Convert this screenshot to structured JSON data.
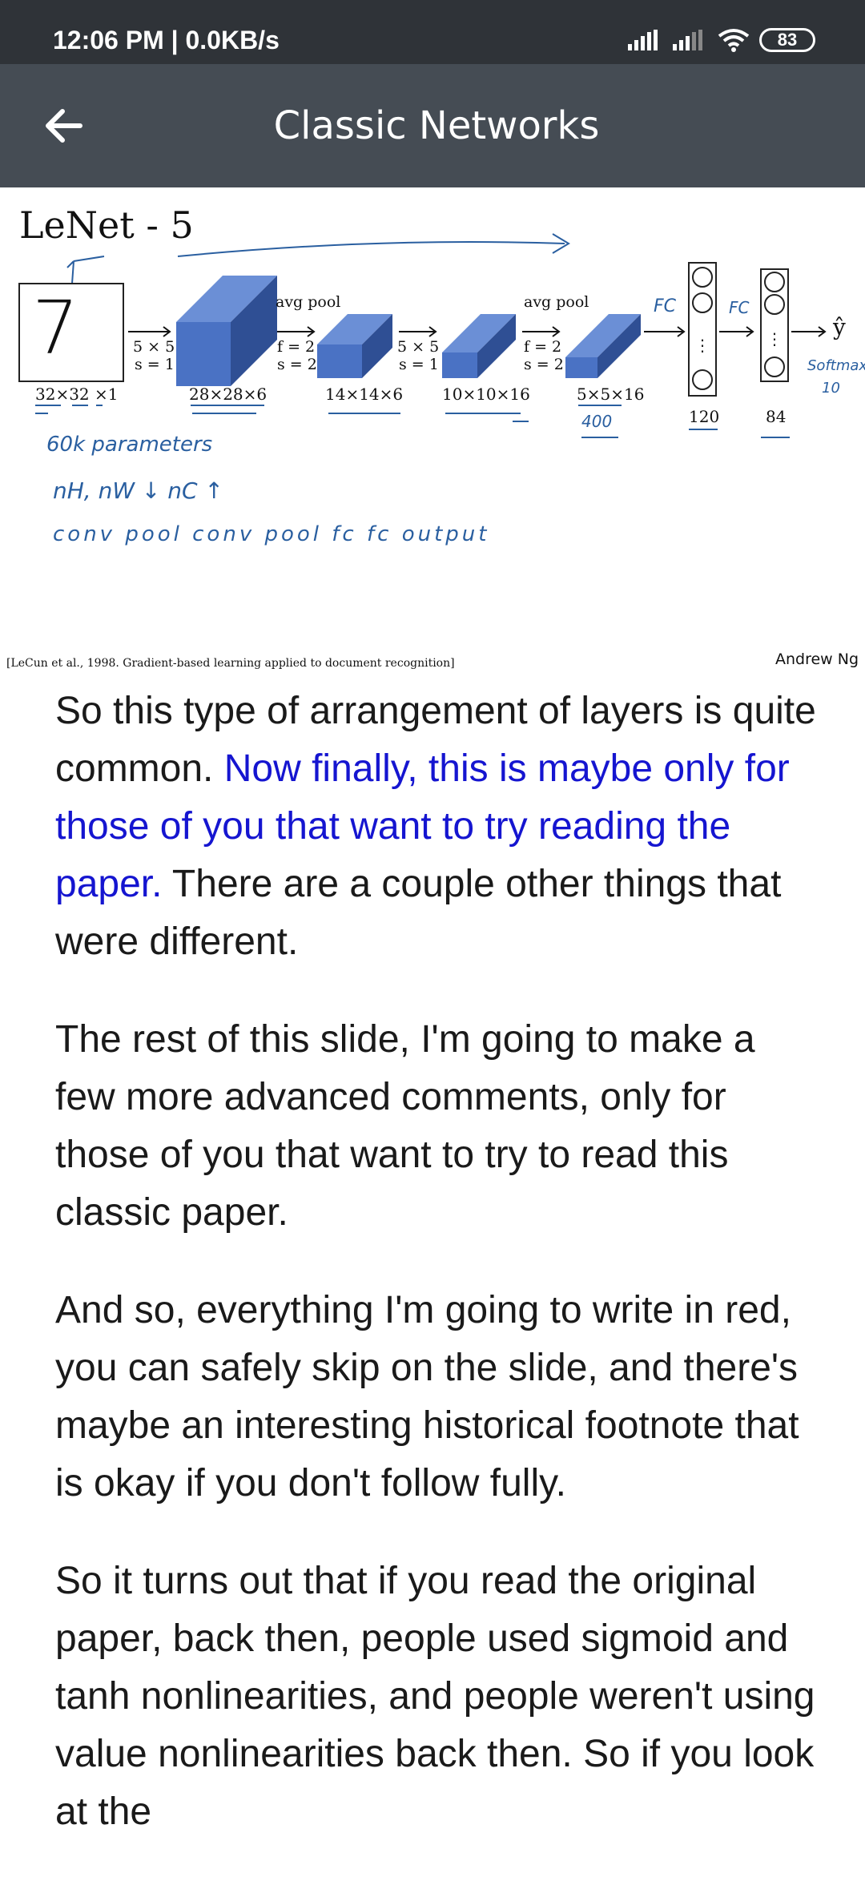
{
  "status_bar": {
    "time_speed": "12:06 PM | 0.0KB/s",
    "battery": "83"
  },
  "app_bar": {
    "title": "Classic Networks",
    "back_icon": "arrow-left-icon"
  },
  "slide": {
    "title": "LeNet - 5",
    "input_digit": "7",
    "input_dim": "32×32 ×1",
    "conv1_dim": "28×28×6",
    "pool1_dim": "14×14×6",
    "conv2_dim": "10×10×16",
    "pool2_dim": "5×5×16",
    "conv1_filter": "5 × 5",
    "conv1_stride": "s = 1",
    "pool1_label": "avg pool",
    "pool1_f": "f = 2",
    "pool1_s": "s = 2",
    "conv2_filter": "5 × 5",
    "conv2_stride": "s = 1",
    "pool2_label": "avg pool",
    "pool2_f": "f = 2",
    "pool2_s": "s = 2",
    "fc1_size": "120",
    "fc2_size": "84",
    "output_symbol": "ŷ",
    "citation": "[LeCun et al., 1998. Gradient-based learning applied to document recognition]",
    "author": "Andrew Ng",
    "hand_fc1": "FC",
    "hand_fc2": "FC",
    "hand_softmax": "Softmax",
    "hand_ten": "10",
    "hand_400": "400",
    "hand_params": "60k parameters",
    "hand_dims": "nH, nW ↓   nC ↑",
    "hand_layers": "conv pool conv pool fc fc output",
    "colors": {
      "block": "#4a72c4",
      "block_top": "#6b8fd6",
      "block_side": "#2f4f94",
      "ink": "#2a5fa0"
    }
  },
  "transcript": {
    "p1_a": "So this type of arrangement of layers is quite common. ",
    "p1_highlight": "Now finally, this is maybe only for those of you that want to try reading the paper.",
    "p1_b": " There are a couple other things that were different.",
    "p2": "The rest of this slide, I'm going to make a few more advanced comments, only for those of you that want to try to read this classic paper.",
    "p3": "And so, everything I'm going to write in red, you can safely skip on the slide, and there's maybe an interesting historical footnote that is okay if you don't follow fully.",
    "p4": "So it turns out that if you read the original paper, back then, people used sigmoid and tanh nonlinearities, and people weren't using value nonlinearities back then. So if you look at the"
  }
}
